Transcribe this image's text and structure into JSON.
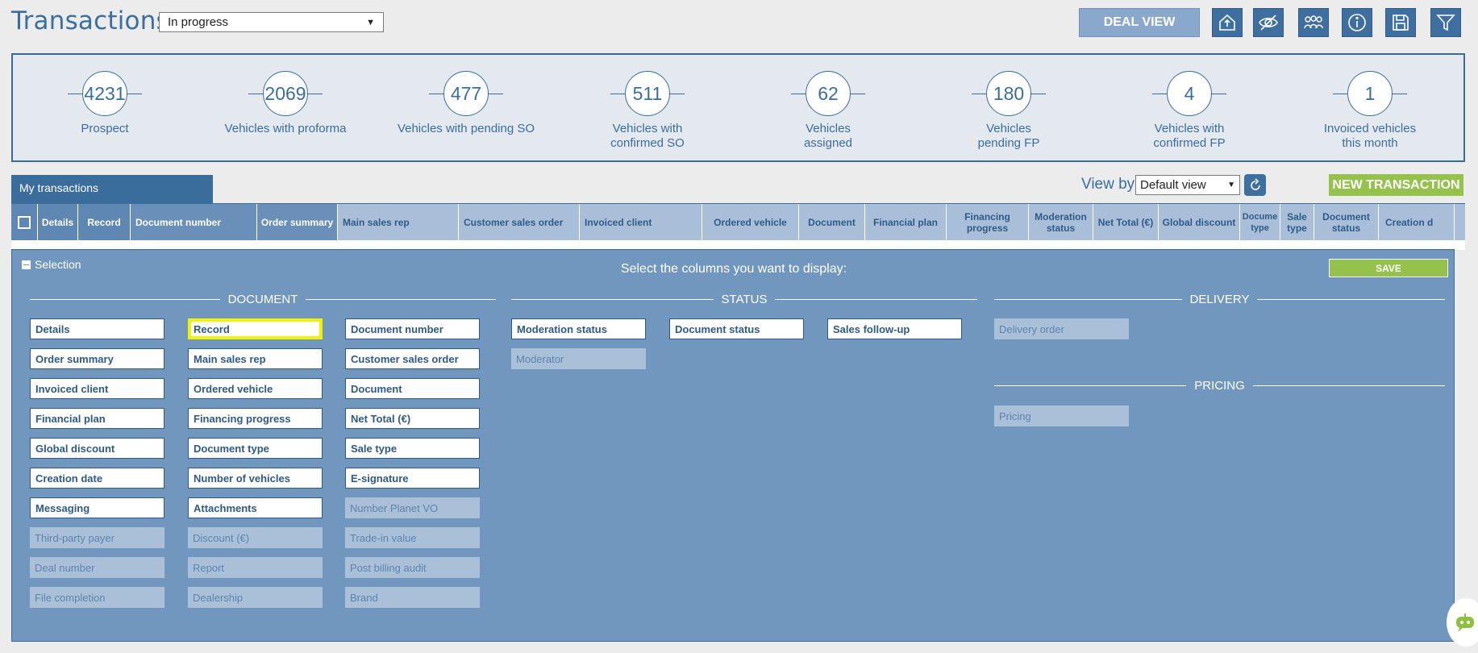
{
  "header": {
    "title": "Transactions",
    "status_value": "In progress",
    "deal_view_label": "DEAL VIEW"
  },
  "toolbar": [
    {
      "name": "export-icon"
    },
    {
      "name": "hide-icon"
    },
    {
      "name": "team-icon"
    },
    {
      "name": "info-icon"
    },
    {
      "name": "save-icon"
    },
    {
      "name": "filter-icon"
    }
  ],
  "stats": [
    {
      "value": "4231",
      "label": "Prospect"
    },
    {
      "value": "2069",
      "label": "Vehicles with proforma"
    },
    {
      "value": "477",
      "label": "Vehicles with pending SO"
    },
    {
      "value": "511",
      "label": "Vehicles with confirmed SO"
    },
    {
      "value": "62",
      "label": "Vehicles assigned"
    },
    {
      "value": "180",
      "label": "Vehicles pending FP"
    },
    {
      "value": "4",
      "label": "Vehicles with confirmed FP"
    },
    {
      "value": "1",
      "label": "Invoiced vehicles this month"
    }
  ],
  "transactions": {
    "tab_label": "My transactions",
    "view_by_label": "View by",
    "view_value": "Default view",
    "new_label": "NEW TRANSACTION"
  },
  "table": {
    "columns": [
      "Details",
      "Record",
      "Document number",
      "Order summary",
      "Main sales rep",
      "Customer sales order",
      "Invoiced client",
      "Ordered vehicle",
      "Document",
      "Financial plan",
      "Financing progress",
      "Moderation status",
      "Net Total (€)",
      "Global discount",
      "Docume type",
      "Sale type",
      "Document status",
      "Creation d"
    ]
  },
  "selection": {
    "toggle_label": "Selection",
    "heading": "Select the columns you want to display:",
    "save_label": "SAVE",
    "groups": {
      "document": "DOCUMENT",
      "status": "STATUS",
      "delivery": "DELIVERY",
      "pricing": "PRICING"
    },
    "document_columns": [
      [
        "Details",
        "Record",
        "Document number"
      ],
      [
        "Order summary",
        "Main sales rep",
        "Customer sales order"
      ],
      [
        "Invoiced client",
        "Ordered vehicle",
        "Document"
      ],
      [
        "Financial plan",
        "Financing progress",
        "Net Total (€)"
      ],
      [
        "Global discount",
        "Document type",
        "Sale type"
      ],
      [
        "Creation date",
        "Number of vehicles",
        "E-signature"
      ],
      [
        "Messaging",
        "Attachments",
        "Number Planet VO"
      ],
      [
        "Third-party payer",
        "Discount (€)",
        "Trade-in value"
      ],
      [
        "Deal number",
        "Report",
        "Post billing audit"
      ],
      [
        "File completion",
        "Dealership",
        "Brand"
      ]
    ],
    "status_columns": [
      "Moderation status",
      "Document status",
      "Sales follow-up",
      "Moderator"
    ],
    "delivery_columns": [
      "Delivery order"
    ],
    "pricing_columns": [
      "Pricing"
    ]
  },
  "colors": {
    "primary": "#3a6d9c",
    "accent_green": "#95c24c",
    "overlay": "#7197be",
    "highlight": "#f2f200"
  }
}
